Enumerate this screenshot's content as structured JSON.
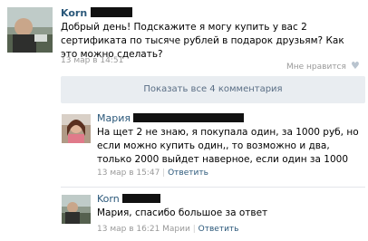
{
  "post": {
    "author": "Korn",
    "text": "Добрый день! Подскажите я могу купить у вас 2 сертификата по тысяче рублей в подарок друзьям? Как это можно сделать?",
    "time": "13 мар в 14:51",
    "like_label": "Мне нравится",
    "heart_icon": "heart-icon"
  },
  "show_comments": "Показать все 4 комментария",
  "comments": [
    {
      "author": "Мария",
      "text": "На щет 2 не знаю, я покупала один, за 1000 руб, но если можно купить один,, то возможно и два, только 2000 выйдет наверное, если один за 1000",
      "time": "13 мар в 15:47",
      "reply": "Ответить"
    },
    {
      "author": "Korn",
      "text": "Мария, спасибо большое за ответ",
      "time": "13 мар в 16:21 Марии",
      "reply": "Ответить"
    }
  ]
}
